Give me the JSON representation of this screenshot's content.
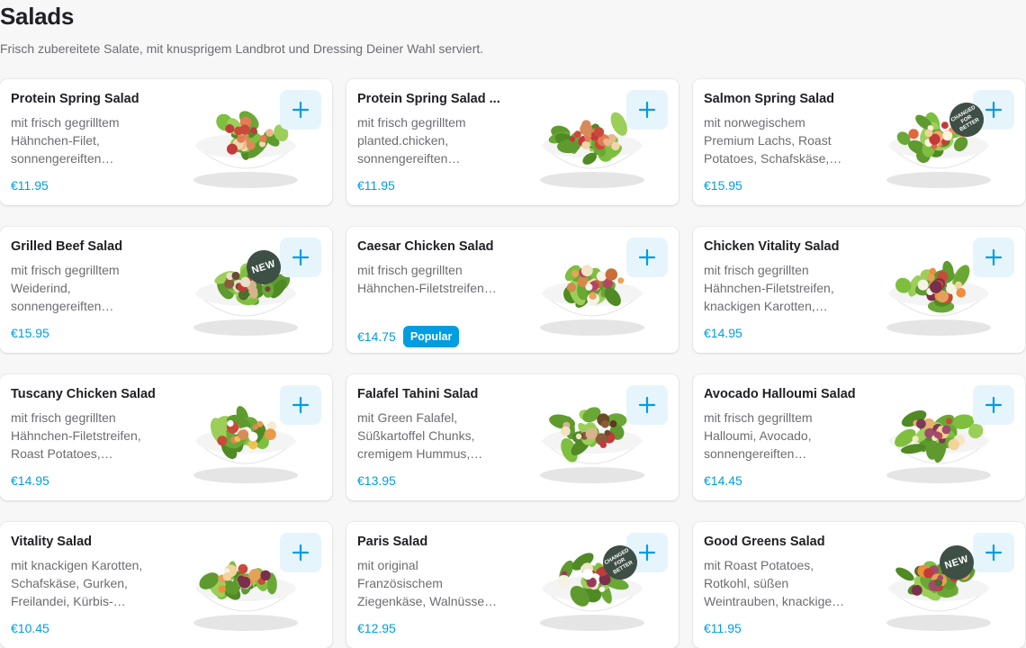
{
  "page": {
    "title": "Salads",
    "subtitle": "Frisch zubereitete Salate, mit knusprigem Landbrot und Dressing Deiner Wahl serviert."
  },
  "colors": {
    "accent": "#009de0",
    "add_button_bg": "#e6f5fc",
    "badge_green": "#3e4f45"
  },
  "badges": {
    "new": "NEW",
    "changed_line1": "CHANGED",
    "changed_line2": "FOR BETTER",
    "popular": "Popular"
  },
  "items": [
    {
      "name": "Protein Spring Salad",
      "desc": [
        "mit frisch gegrilltem",
        "Hähnchen-Filet,",
        "sonnengereiften…"
      ],
      "price": "€11.95",
      "badge": "",
      "popular": false,
      "salad": "protein"
    },
    {
      "name": "Protein Spring Salad ...",
      "desc": [
        "mit frisch gegrilltem",
        "planted.chicken,",
        "sonnengereiften…"
      ],
      "price": "€11.95",
      "badge": "",
      "popular": false,
      "salad": "protein"
    },
    {
      "name": "Salmon Spring Salad",
      "desc": [
        "mit norwegischem",
        "Premium Lachs, Roast",
        "Potatoes, Schafskäse,…"
      ],
      "price": "€15.95",
      "badge": "changed",
      "popular": false,
      "salad": "salmon"
    },
    {
      "name": "Grilled Beef Salad",
      "desc": [
        "mit frisch gegrilltem",
        "Weiderind,",
        "sonnengereiften…"
      ],
      "price": "€15.95",
      "badge": "new",
      "popular": false,
      "salad": "beef"
    },
    {
      "name": "Caesar Chicken Salad",
      "desc": [
        "mit frisch gegrillten",
        "Hähnchen-Filetstreifen…"
      ],
      "price": "€14.75",
      "badge": "",
      "popular": true,
      "salad": "caesar"
    },
    {
      "name": "Chicken Vitality Salad",
      "desc": [
        "mit frisch gegrillten",
        "Hähnchen-Filetstreifen,",
        "knackigen Karotten,…"
      ],
      "price": "€14.95",
      "badge": "",
      "popular": false,
      "salad": "vitality"
    },
    {
      "name": "Tuscany Chicken Salad",
      "desc": [
        "mit frisch gegrillten",
        "Hähnchen-Filetstreifen,",
        "Roast Potatoes,…"
      ],
      "price": "€14.95",
      "badge": "",
      "popular": false,
      "salad": "tuscany"
    },
    {
      "name": "Falafel Tahini Salad",
      "desc": [
        "mit Green Falafel,",
        "Süßkartoffel Chunks,",
        "cremigem Hummus,…"
      ],
      "price": "€13.95",
      "badge": "",
      "popular": false,
      "salad": "falafel"
    },
    {
      "name": "Avocado Halloumi Salad",
      "desc": [
        "mit frisch gegrilltem",
        "Halloumi, Avocado,",
        "sonnengereiften…"
      ],
      "price": "€14.45",
      "badge": "",
      "popular": false,
      "salad": "halloumi"
    },
    {
      "name": "Vitality Salad",
      "desc": [
        "mit knackigen Karotten,",
        "Schafskäse, Gurken,",
        "Freilandei, Kürbis-…"
      ],
      "price": "€10.45",
      "badge": "",
      "popular": false,
      "salad": "vitality"
    },
    {
      "name": "Paris Salad",
      "desc": [
        "mit original",
        "Französischem",
        "Ziegenkäse, Walnüsse…"
      ],
      "price": "€12.95",
      "badge": "changed",
      "popular": false,
      "salad": "paris"
    },
    {
      "name": "Good Greens Salad",
      "desc": [
        "mit Roast Potatoes,",
        "Rotkohl, süßen",
        "Weintrauben, knackige…"
      ],
      "price": "€11.95",
      "badge": "new",
      "popular": false,
      "salad": "greens"
    }
  ]
}
